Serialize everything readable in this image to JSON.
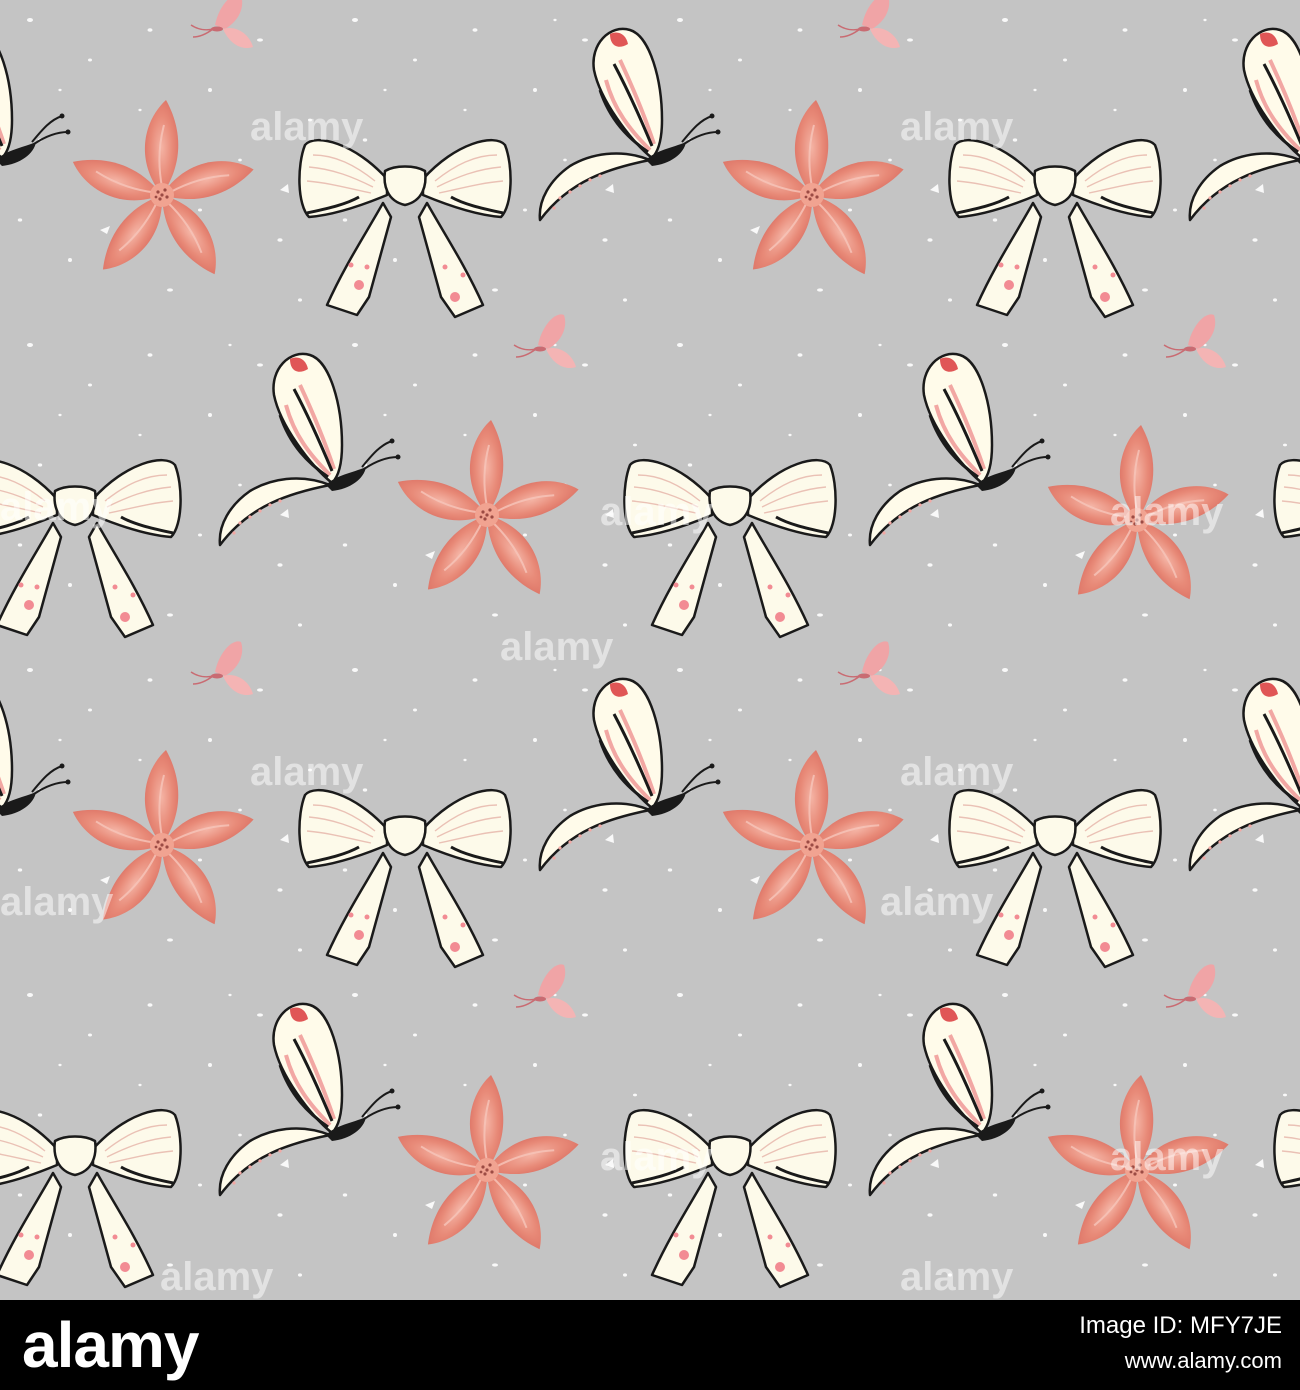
{
  "pattern": {
    "description_items": [
      "bow",
      "flower",
      "butterfly",
      "small-butterfly"
    ],
    "colors": {
      "background": "#c4c4c4",
      "flower": "#e88a78",
      "flower_dark": "#d86a5e",
      "bow_fill": "#fdfaea",
      "bow_outline": "#1a1a1a",
      "butterfly_fill": "#fffbea",
      "butterfly_accent": "#f2a7a3",
      "small_butterfly": "#f0a4a6",
      "speckle": "#ffffff",
      "dot": "#f28b93"
    }
  },
  "watermark": {
    "text": "alamy"
  },
  "footer": {
    "logo": "alamy",
    "image_id": "Image ID: MFY7JE",
    "url": "www.alamy.com"
  }
}
